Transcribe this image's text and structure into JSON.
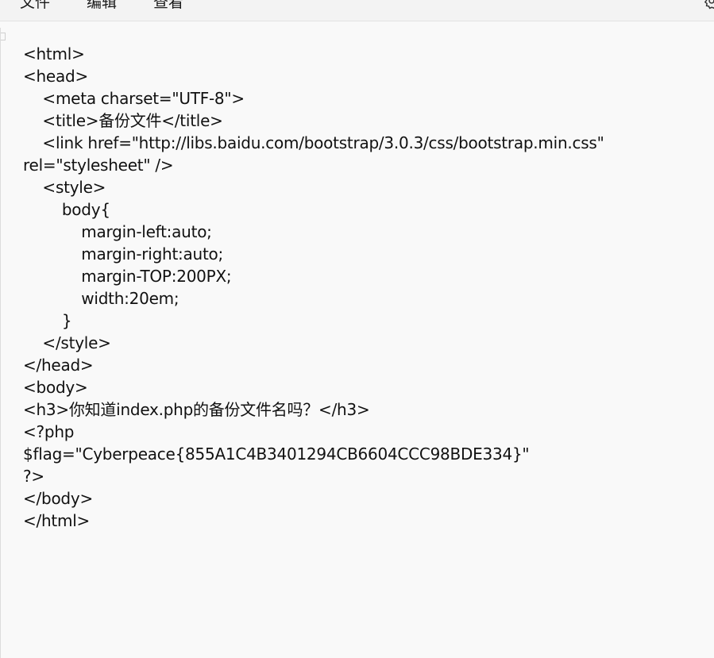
{
  "menu": {
    "file": "文件",
    "edit": "编辑",
    "view": "查看"
  },
  "icons": {
    "settings": "gear-icon"
  },
  "editor": {
    "lines": [
      "<html>",
      "<head>",
      "    <meta charset=\"UTF-8\">",
      "    <title>备份文件</title>",
      "    <link href=\"http://libs.baidu.com/bootstrap/3.0.3/css/bootstrap.min.css\"",
      "rel=\"stylesheet\" />",
      "    <style>",
      "        body{",
      "            margin-left:auto;",
      "            margin-right:auto;",
      "            margin-TOP:200PX;",
      "            width:20em;",
      "        }",
      "    </style>",
      "</head>",
      "<body>",
      "<h3>你知道index.php的备份文件名吗？</h3>",
      "<?php",
      "$flag=\"Cyberpeace{855A1C4B3401294CB6604CCC98BDE334}\"",
      "?>",
      "</body>",
      "</html>"
    ]
  }
}
